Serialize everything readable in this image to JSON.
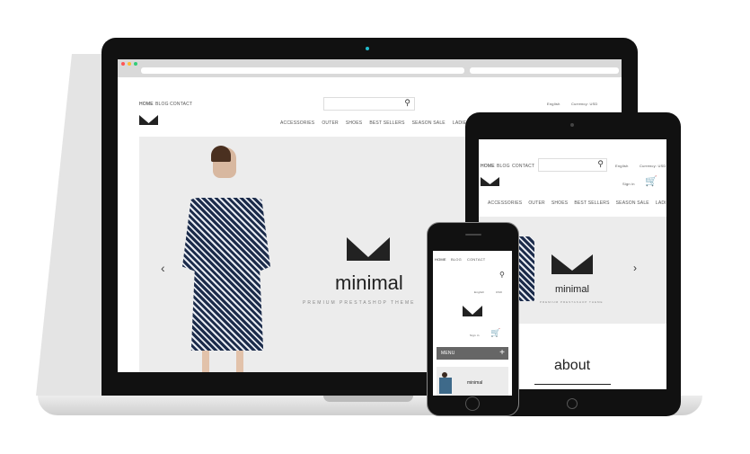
{
  "site": {
    "nav": [
      "HOME",
      "BLOG",
      "CONTACT"
    ],
    "language": "English",
    "currency": "Currency: USD",
    "currency_short": "USD",
    "sign_in": "Sign in",
    "menu": [
      "ACCESSORIES",
      "OUTER",
      "SHOES",
      "BEST SELLERS",
      "SEASON SALE",
      "LADIES"
    ],
    "brand": "minimal",
    "tagline": "PREMIUM PRESTASHOP THEME",
    "about": "about",
    "mobile_menu": "MENU",
    "prev_icon": "chevron-left",
    "next_icon": "chevron-right",
    "cart_icon": "cart",
    "search_icon": "magnifier"
  },
  "colors": {
    "hero_bg": "#ececec",
    "device": "#111111",
    "menu_bar": "#666666"
  }
}
